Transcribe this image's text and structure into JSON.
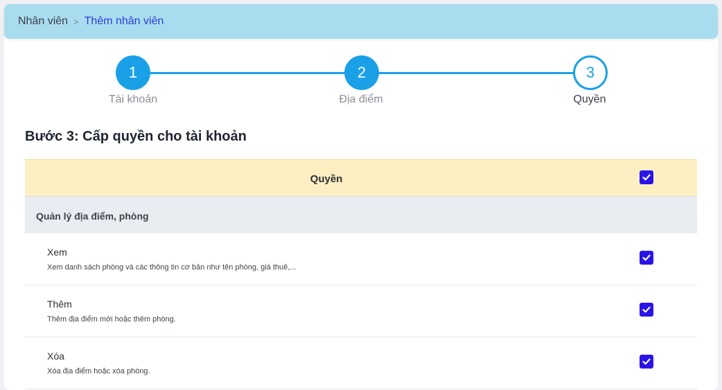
{
  "breadcrumb": {
    "root": "Nhân viên",
    "separator": ">",
    "current": "Thêm nhân viên"
  },
  "stepper": {
    "steps": [
      {
        "number": "1",
        "label": "Tài khoản",
        "state": "done"
      },
      {
        "number": "2",
        "label": "Địa điểm",
        "state": "done"
      },
      {
        "number": "3",
        "label": "Quyền",
        "state": "active"
      }
    ]
  },
  "section_title": "Bước 3: Cấp quyền cho tài khoản",
  "table": {
    "header_label": "Quyền",
    "header_checked": true,
    "groups": [
      {
        "label": "Quản lý địa điểm, phòng",
        "permissions": [
          {
            "title": "Xem",
            "description": "Xem danh sách phòng và các thông tin cơ bản như tên phòng, giá thuê,...",
            "checked": true
          },
          {
            "title": "Thêm",
            "description": "Thêm địa điểm mới hoặc thêm phòng.",
            "checked": true
          },
          {
            "title": "Xóa",
            "description": "Xóa địa điểm hoặc xóa phòng.",
            "checked": true
          }
        ]
      }
    ]
  },
  "colors": {
    "breadcrumb_bg": "#a9dcef",
    "step_accent": "#1aa0e6",
    "checkbox": "#2a15e8",
    "table_header_bg": "#fdefc2",
    "group_row_bg": "#e9ecf1"
  }
}
